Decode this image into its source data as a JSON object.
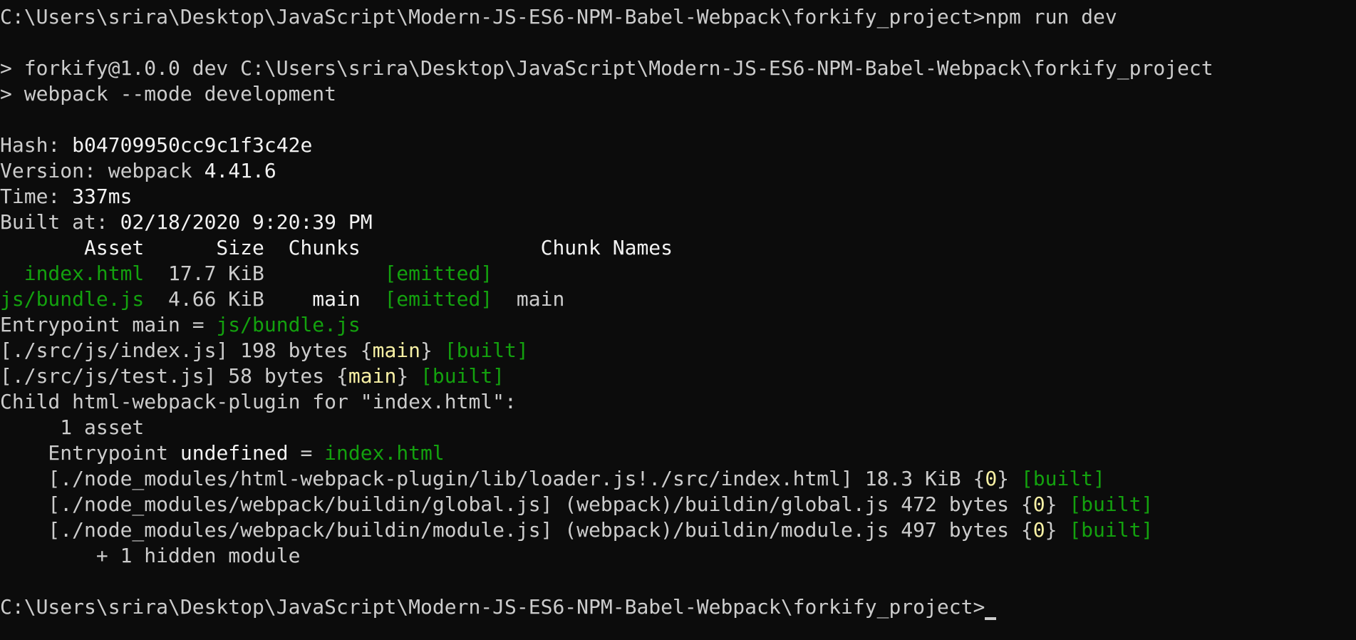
{
  "colors": {
    "background": "#0c0c0c",
    "text": "#cccccc",
    "bright": "#f2f2f2",
    "green": "#13a10e",
    "yellow": "#f9f1a5"
  },
  "terminal": {
    "command_prompt": "C:\\Users\\srira\\Desktop\\JavaScript\\Modern-JS-ES6-NPM-Babel-Webpack\\forkify_project>",
    "command_text": "npm run dev",
    "script_line_1": "> forkify@1.0.0 dev C:\\Users\\srira\\Desktop\\JavaScript\\Modern-JS-ES6-NPM-Babel-Webpack\\forkify_project",
    "script_line_2": "> webpack --mode development",
    "hash_label": "Hash: ",
    "hash_value": "b04709950cc9c1f3c42e",
    "version_label": "Version: webpack ",
    "version_value": "4.41.6",
    "time_label": "Time: ",
    "time_value": "337ms",
    "built_label": "Built at: ",
    "built_value": "02/18/2020 9:20:39 PM",
    "asset_table": {
      "header": "       Asset      Size  Chunks               Chunk Names",
      "rows": [
        {
          "pad": "  ",
          "asset": "index.html",
          "size": "  17.7 KiB",
          "chunks": "          ",
          "status": "[emitted]",
          "names": ""
        },
        {
          "pad": "",
          "asset": "js/bundle.js",
          "size": "  4.66 KiB",
          "chunks": "    main  ",
          "status": "[emitted]",
          "names": "  main"
        }
      ]
    },
    "entrypoint_label": "Entrypoint main = ",
    "entrypoint_value": "js/bundle.js",
    "modules": [
      {
        "path": "[./src/js/index.js] 198 bytes {",
        "chunk": "main",
        "close": "} ",
        "status": "[built]"
      },
      {
        "path": "[./src/js/test.js] 58 bytes {",
        "chunk": "main",
        "close": "} ",
        "status": "[built]"
      }
    ],
    "child_line": "Child html-webpack-plugin for \"index.html\":",
    "child_asset": "     1 asset",
    "child_entry_label": "    Entrypoint ",
    "child_entry_mid": "undefined",
    "child_entry_eq": " = ",
    "child_entry_value": "index.html",
    "child_modules": [
      {
        "path": "    [./node_modules/html-webpack-plugin/lib/loader.js!./src/index.html] 18.3 KiB {",
        "chunk": "0",
        "close": "} ",
        "status": "[built]"
      },
      {
        "path": "    [./node_modules/webpack/buildin/global.js] (webpack)/buildin/global.js 472 bytes {",
        "chunk": "0",
        "close": "} ",
        "status": "[built]"
      },
      {
        "path": "    [./node_modules/webpack/buildin/module.js] (webpack)/buildin/module.js 497 bytes {",
        "chunk": "0",
        "close": "} ",
        "status": "[built]"
      }
    ],
    "hidden_module": "        + 1 hidden module",
    "final_prompt": "C:\\Users\\srira\\Desktop\\JavaScript\\Modern-JS-ES6-NPM-Babel-Webpack\\forkify_project>"
  }
}
